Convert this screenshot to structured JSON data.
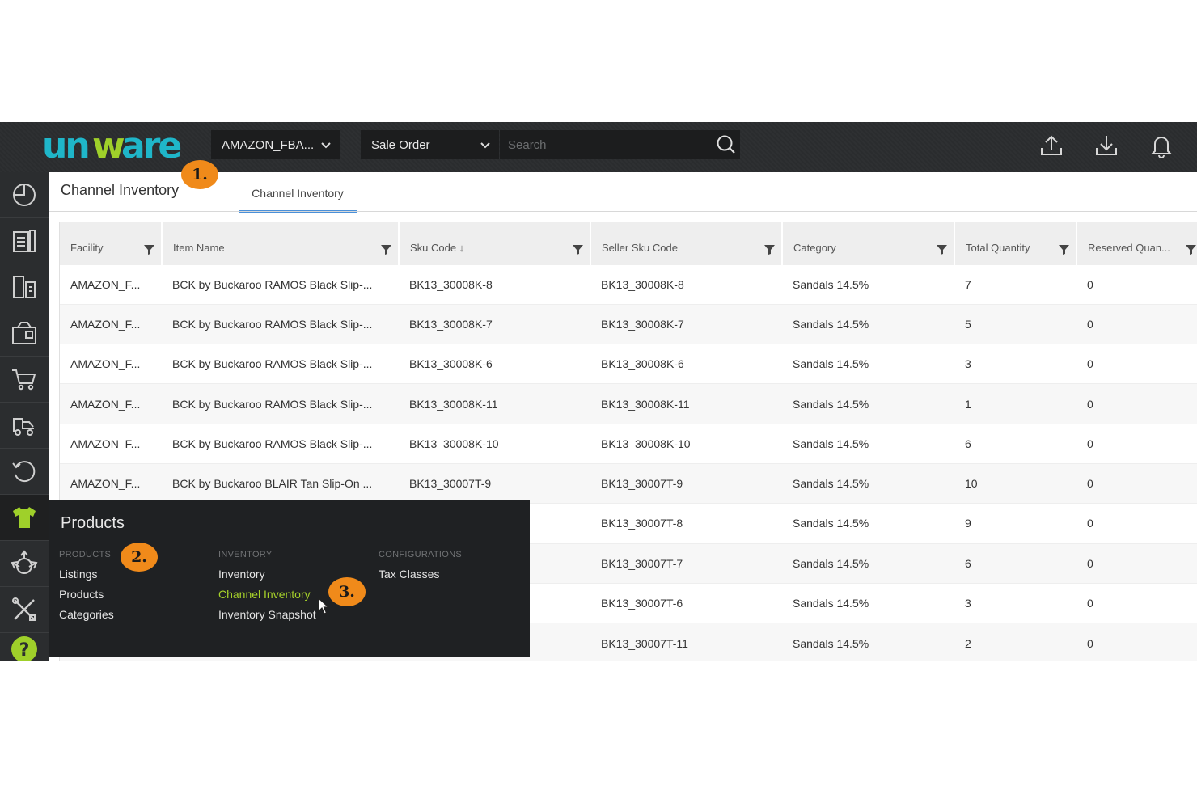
{
  "topbar": {
    "logo_text": "unware",
    "facility_select": "AMAZON_FBA...",
    "type_select": "Sale Order",
    "search_placeholder": "Search"
  },
  "page": {
    "title": "Channel Inventory",
    "tab": "Channel Inventory"
  },
  "table": {
    "headers": [
      "Facility",
      "Item Name",
      "Sku Code ↓",
      "Seller Sku Code",
      "Category",
      "Total Quantity",
      "Reserved Quan..."
    ],
    "rows": [
      [
        "AMAZON_F...",
        "BCK by Buckaroo RAMOS Black Slip-...",
        "BK13_30008K-8",
        "BK13_30008K-8",
        "Sandals 14.5%",
        "7",
        "0"
      ],
      [
        "AMAZON_F...",
        "BCK by Buckaroo RAMOS Black Slip-...",
        "BK13_30008K-7",
        "BK13_30008K-7",
        "Sandals 14.5%",
        "5",
        "0"
      ],
      [
        "AMAZON_F...",
        "BCK by Buckaroo RAMOS Black Slip-...",
        "BK13_30008K-6",
        "BK13_30008K-6",
        "Sandals 14.5%",
        "3",
        "0"
      ],
      [
        "AMAZON_F...",
        "BCK by Buckaroo RAMOS Black Slip-...",
        "BK13_30008K-11",
        "BK13_30008K-11",
        "Sandals 14.5%",
        "1",
        "0"
      ],
      [
        "AMAZON_F...",
        "BCK by Buckaroo RAMOS Black Slip-...",
        "BK13_30008K-10",
        "BK13_30008K-10",
        "Sandals 14.5%",
        "6",
        "0"
      ],
      [
        "AMAZON_F...",
        "BCK by Buckaroo BLAIR Tan Slip-On ...",
        "BK13_30007T-9",
        "BK13_30007T-9",
        "Sandals 14.5%",
        "10",
        "0"
      ],
      [
        "",
        "",
        "",
        "BK13_30007T-8",
        "Sandals 14.5%",
        "9",
        "0"
      ],
      [
        "",
        "",
        "",
        "BK13_30007T-7",
        "Sandals 14.5%",
        "6",
        "0"
      ],
      [
        "",
        "",
        "",
        "BK13_30007T-6",
        "Sandals 14.5%",
        "3",
        "0"
      ],
      [
        "",
        "",
        "",
        "BK13_30007T-11",
        "Sandals 14.5%",
        "2",
        "0"
      ]
    ]
  },
  "flyout": {
    "title": "Products",
    "columns": [
      {
        "heading": "PRODUCTS",
        "links": [
          "Listings",
          "Products",
          "Categories"
        ]
      },
      {
        "heading": "INVENTORY",
        "links": [
          "Inventory",
          "Channel Inventory",
          "Inventory Snapshot"
        ]
      },
      {
        "heading": "CONFIGURATIONS",
        "links": [
          "Tax Classes"
        ]
      }
    ],
    "active_link": "Channel Inventory"
  },
  "markers": [
    "1.",
    "2.",
    "3."
  ],
  "sidebar_icons": [
    "dashboard-icon",
    "orders-icon",
    "returns-icon",
    "inbound-icon",
    "cart-icon",
    "dispatch-icon",
    "refresh-icon",
    "products-icon",
    "recycle-icon",
    "tools-icon",
    "help-icon"
  ],
  "colors": {
    "topbar_bg": "#2b2d2f",
    "accent_green": "#a6d12a",
    "tab_underline": "#4a90d9",
    "marker_orange": "#f08a1a",
    "logo_teal": "#1fb6c9",
    "logo_green": "#9fd02a"
  }
}
